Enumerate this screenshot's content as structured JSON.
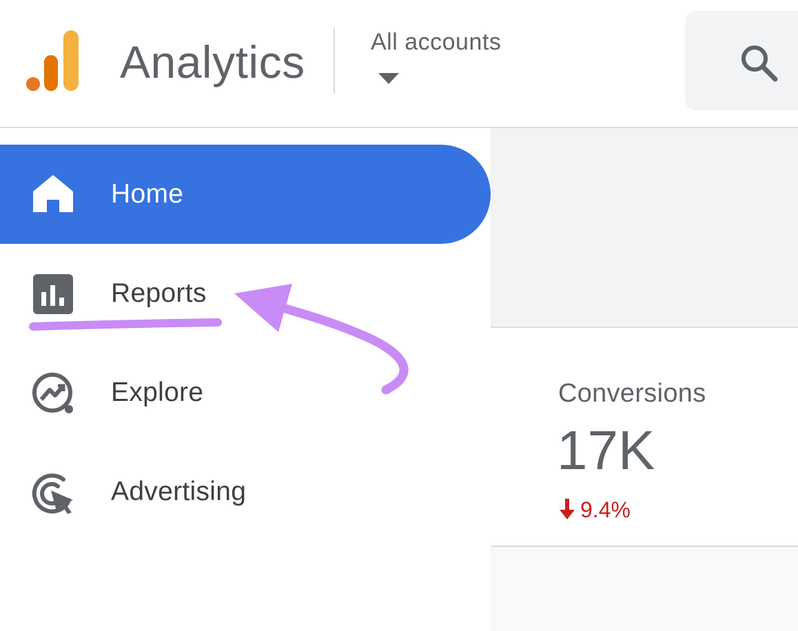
{
  "header": {
    "app_title": "Analytics",
    "account_selector": "All accounts",
    "logo_colors": [
      "#e37400",
      "#e87722",
      "#f9ab00"
    ]
  },
  "search": {
    "icon": "search-icon"
  },
  "sidebar": {
    "items": [
      {
        "label": "Home",
        "icon": "home-icon",
        "active": true
      },
      {
        "label": "Reports",
        "icon": "bar-chart-icon",
        "active": false
      },
      {
        "label": "Explore",
        "icon": "explore-icon",
        "active": false
      },
      {
        "label": "Advertising",
        "icon": "advertising-icon",
        "active": false
      }
    ]
  },
  "main": {
    "metric": {
      "name": "Conversions",
      "value": "17K",
      "change": "9.4%",
      "direction": "down",
      "change_color": "#c5221f"
    }
  },
  "colors": {
    "active_nav": "#3672e0",
    "annotation": "#c98bf5"
  }
}
